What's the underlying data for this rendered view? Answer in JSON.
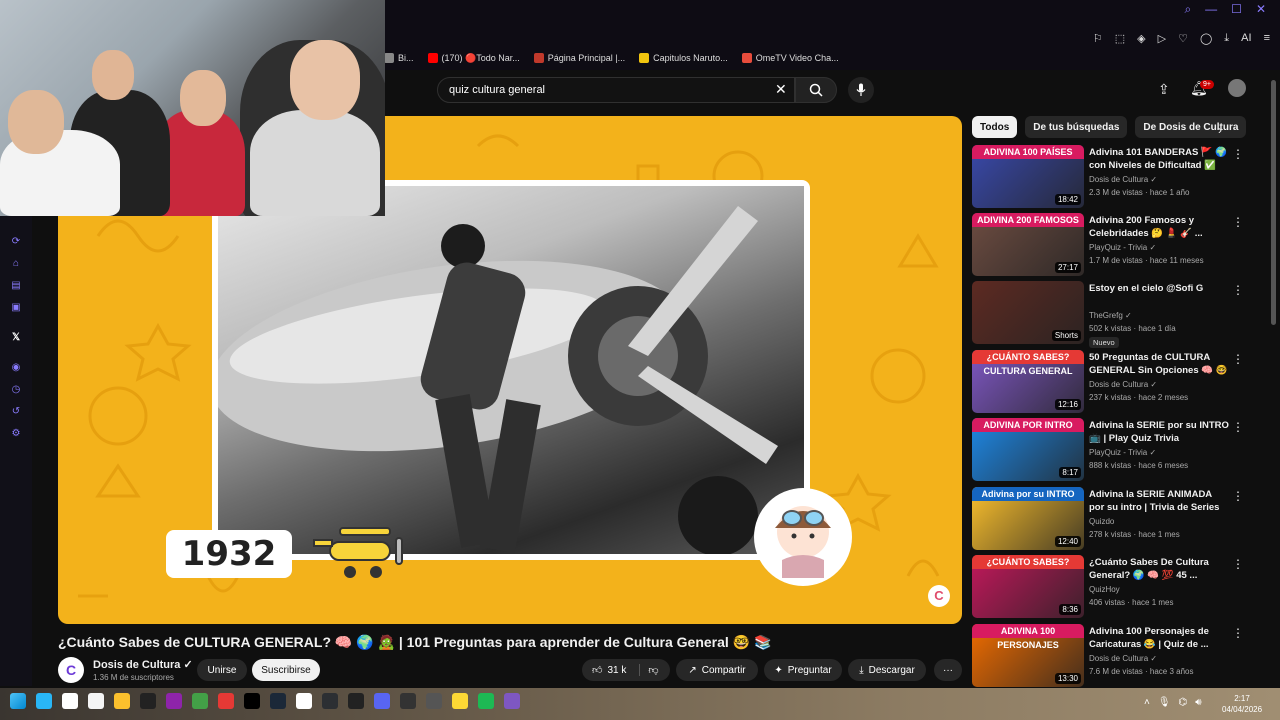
{
  "bookmarks": [
    {
      "label": "Bi...",
      "color": "#888888"
    },
    {
      "label": "(170) 🔴Todo Nar...",
      "color": "#ff0000"
    },
    {
      "label": "Página Principal |...",
      "color": "#c0392b"
    },
    {
      "label": "Capitulos Naruto...",
      "color": "#f1c40f"
    },
    {
      "label": "OmeTV Video Cha...",
      "color": "#e74c3c"
    }
  ],
  "browser_icons": [
    "AI"
  ],
  "search": {
    "value": "quiz cultura general",
    "placeholder": "Buscar"
  },
  "header": {
    "notif_badge": "9+"
  },
  "video": {
    "year_label": "1932",
    "logo_letter": "C",
    "title": "¿Cuánto Sabes de CULTURA GENERAL? 🧠 🌍 🧟 | 101 Preguntas para aprender de Cultura General 🤓 📚"
  },
  "channel": {
    "avatar_letter": "C",
    "name": "Dosis de Cultura ✓",
    "subs": "1.36 M de suscriptores",
    "join_label": "Unirse",
    "subscribe_label": "Suscribirse"
  },
  "actions": {
    "likes": "31 k",
    "share": "Compartir",
    "ask": "Preguntar",
    "download": "Descargar",
    "more": "···"
  },
  "chips": [
    {
      "label": "Todos",
      "active": true
    },
    {
      "label": "De tus búsquedas",
      "active": false
    },
    {
      "label": "De Dosis de Cultura",
      "active": false
    }
  ],
  "recommendations": [
    {
      "band": "ADIVINA 100 PAÍSES",
      "band_color": "#d81b60",
      "thumb_color": "#3949ab",
      "duration": "18:42",
      "title": "Adivina 101 BANDERAS 🚩 🌍 con Niveles de Dificultad ✅ -...",
      "channel": "Dosis de Cultura ✓",
      "meta": "2.3 M de vistas · hace 1 año"
    },
    {
      "band": "ADIVINA 200 FAMOSOS",
      "band_color": "#d81b60",
      "thumb_color": "#6d4c41",
      "duration": "27:17",
      "title": "Adivina 200 Famosos y Celebridades 🤔 💄 🎸 ...",
      "channel": "PlayQuiz - Trivia ✓",
      "meta": "1.7 M de vistas · hace 11 meses"
    },
    {
      "band": "",
      "band_color": "#000000",
      "thumb_color": "#5d2a22",
      "duration": "Shorts",
      "title": "Estoy en el cielo @Sofi G",
      "channel": "TheGrefg ✓",
      "meta": "502 k vistas · hace 1 día",
      "badge": "Nuevo"
    },
    {
      "band": "¿CUÁNTO SABES? CULTURA GENERAL",
      "band_color": "#e53935",
      "thumb_color": "#7e57c2",
      "duration": "12:16",
      "title": "50 Preguntas de CULTURA GENERAL Sin Opciones 🧠 🤓 ...",
      "channel": "Dosis de Cultura ✓",
      "meta": "237 k vistas · hace 2 meses"
    },
    {
      "band": "ADIVINA POR INTRO",
      "band_color": "#d81b60",
      "thumb_color": "#1e88e5",
      "duration": "8:17",
      "title": "Adivina la SERIE por su INTRO 📺 | Play Quiz Trivia",
      "channel": "PlayQuiz - Trivia ✓",
      "meta": "888 k vistas · hace 6 meses"
    },
    {
      "band": "Adivina por su INTRO",
      "band_color": "#1565c0",
      "thumb_color": "#fbc02d",
      "duration": "12:40",
      "title": "Adivina la SERIE ANIMADA por su intro | Trivia de Series",
      "channel": "Quizdo",
      "meta": "278 k vistas · hace 1 mes"
    },
    {
      "band": "¿CUÁNTO SABES?",
      "band_color": "#e53935",
      "thumb_color": "#c2185b",
      "duration": "8:36",
      "title": "¿Cuánto Sabes De Cultura General? 🌍 🧠 💯 45 ...",
      "channel": "QuizHoy",
      "meta": "406 vistas · hace 1 mes"
    },
    {
      "band": "ADIVINA 100 PERSONAJES",
      "band_color": "#d81b60",
      "thumb_color": "#ef6c00",
      "duration": "13:30",
      "title": "Adivina 100 Personajes de Caricaturas 😂 | Quiz de ...",
      "channel": "Dosis de Cultura ✓",
      "meta": "7.6 M de vistas · hace 3 años"
    }
  ],
  "taskbar": {
    "icon_colors": [
      "#29b6f6",
      "#ffffff",
      "#f5f5f5",
      "#fbc02d",
      "#222222",
      "#8e24aa",
      "#43a047",
      "#e53935",
      "#000000",
      "#1b2838",
      "#ffffff",
      "#2c2f33",
      "#222222",
      "#5865f2",
      "#333333",
      "#555555",
      "#fdd835",
      "#1db954",
      "#7e57c2"
    ],
    "clock_time": "2:17",
    "clock_date": "04/04/2026"
  },
  "colors": {
    "accent": "#8a7cff",
    "player_bg": "#f3b21b"
  }
}
